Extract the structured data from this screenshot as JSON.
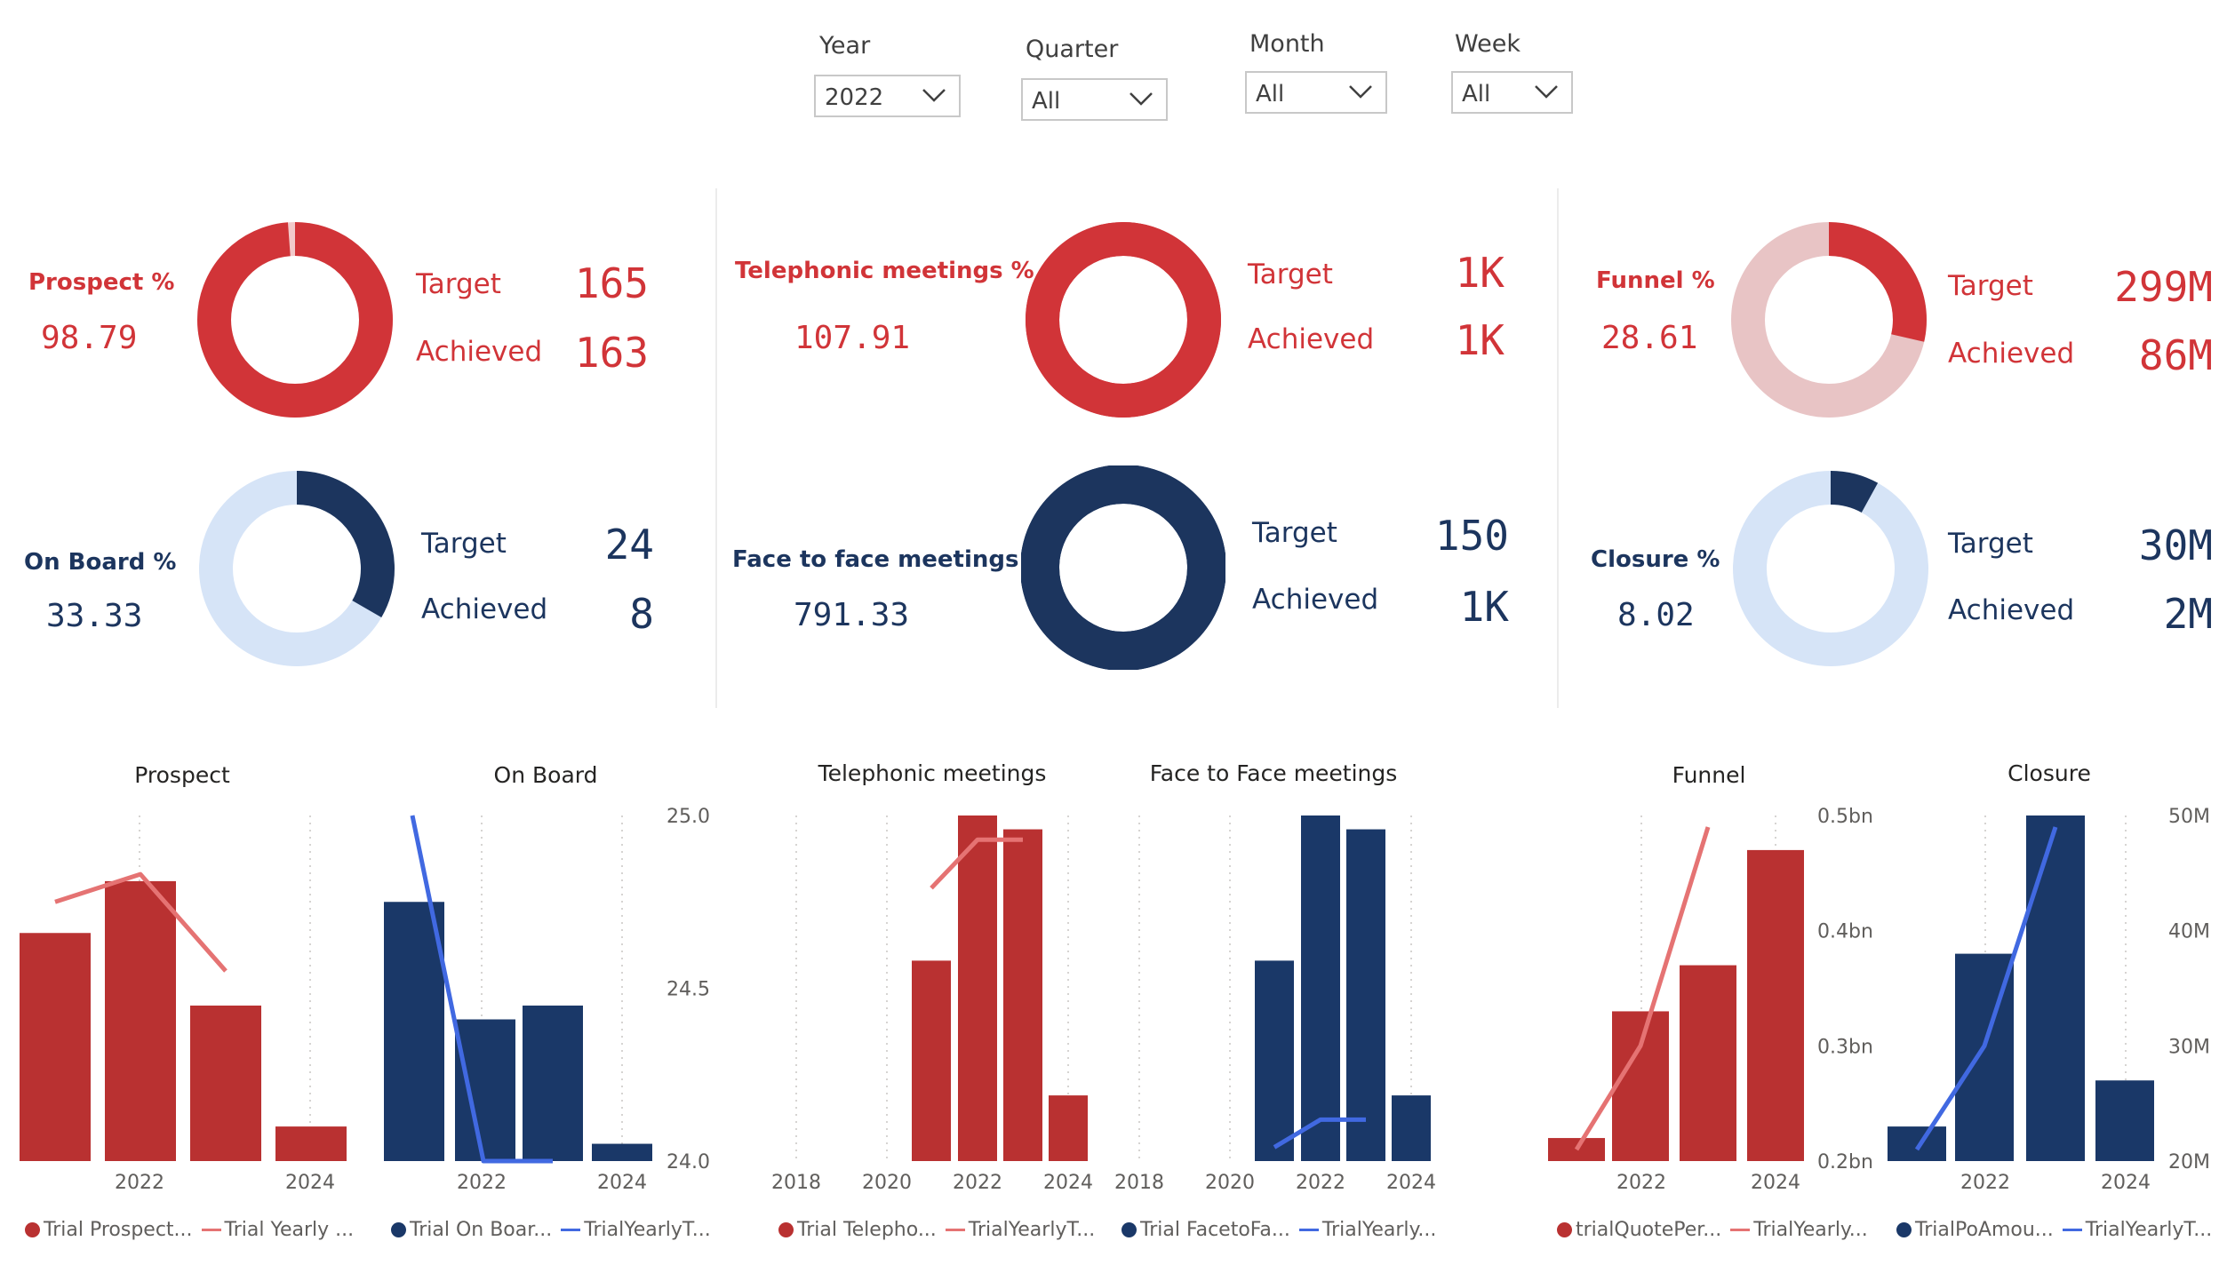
{
  "filters": [
    {
      "label": "Year",
      "value": "2022"
    },
    {
      "label": "Quarter",
      "value": "All"
    },
    {
      "label": "Month",
      "value": "All"
    },
    {
      "label": "Week",
      "value": "All"
    }
  ],
  "kpis": {
    "prospect": {
      "title": "Prospect %",
      "pct": "98.79",
      "target_label": "Target",
      "target": "165",
      "achieved_label": "Achieved",
      "achieved": "163",
      "progress": 0.9879
    },
    "onboard": {
      "title": "On Board %",
      "pct": "33.33",
      "target_label": "Target",
      "target": "24",
      "achieved_label": "Achieved",
      "achieved": "8",
      "progress": 0.3333
    },
    "telephonic": {
      "title": "Telephonic meetings %",
      "pct": "107.91",
      "target_label": "Target",
      "target": "1K",
      "achieved_label": "Achieved",
      "achieved": "1K",
      "progress": 1.0
    },
    "facetoface": {
      "title": "Face to face meetings %",
      "pct": "791.33",
      "target_label": "Target",
      "target": "150",
      "achieved_label": "Achieved",
      "achieved": "1K",
      "progress": 1.0
    },
    "funnel": {
      "title": "Funnel %",
      "pct": "28.61",
      "target_label": "Target",
      "target": "299M",
      "achieved_label": "Achieved",
      "achieved": "86M",
      "progress": 0.2861
    },
    "closure": {
      "title": "Closure %",
      "pct": "8.02",
      "target_label": "Target",
      "target": "30M",
      "achieved_label": "Achieved",
      "achieved": "2M",
      "progress": 0.0802
    }
  },
  "colors": {
    "red": "#d13438",
    "bar_red": "#b93131",
    "line_red": "#e57373",
    "navy": "#1c355e",
    "bar_navy": "#1a3868",
    "line_blue": "#4169e1",
    "light_red": "#e8c4c5",
    "light_blue": "#d6e4f7"
  },
  "chart_data": [
    {
      "type": "bar",
      "title": "Prospect",
      "x": [
        2021,
        2022,
        2023,
        2024
      ],
      "xticks": [
        "2022",
        "2024"
      ],
      "series": [
        {
          "name": "Trial Prospect...",
          "kind": "bar",
          "values": [
            66,
            81,
            45,
            10
          ]
        },
        {
          "name": "Trial Yearly ...",
          "kind": "line",
          "values": [
            75,
            83,
            55,
            null
          ]
        }
      ],
      "ylim": [
        0,
        100
      ],
      "y2ticks": []
    },
    {
      "type": "bar",
      "title": "On Board",
      "x": [
        2021,
        2022,
        2023,
        2024
      ],
      "xticks": [
        "2022",
        "2024"
      ],
      "series": [
        {
          "name": "Trial On Boar...",
          "kind": "bar",
          "values": [
            75,
            41,
            45,
            5
          ]
        },
        {
          "name": "TrialYearlyT...",
          "kind": "line",
          "values": [
            25.0,
            24.0,
            24.0,
            null
          ]
        }
      ],
      "ylim": [
        0,
        100
      ],
      "y2lim": [
        24.0,
        25.0
      ],
      "y2ticks": [
        "25.0",
        "24.5",
        "24.0"
      ]
    },
    {
      "type": "bar",
      "title": "Telephonic meetings",
      "x": [
        2021,
        2022,
        2023,
        2024
      ],
      "xlim": [
        2017.5,
        2024.5
      ],
      "xticks": [
        "2018",
        "2020",
        "2022",
        "2024"
      ],
      "series": [
        {
          "name": "Trial Telepho...",
          "kind": "bar",
          "values": [
            58,
            100,
            96,
            19
          ]
        },
        {
          "name": "TrialYearlyT...",
          "kind": "line",
          "values": [
            79,
            93,
            93,
            null
          ]
        }
      ],
      "ylim": [
        0,
        100
      ],
      "y2ticks": []
    },
    {
      "type": "bar",
      "title": "Face to Face meetings",
      "x": [
        2021,
        2022,
        2023,
        2024
      ],
      "xlim": [
        2017.5,
        2024.5
      ],
      "xticks": [
        "2018",
        "2020",
        "2022",
        "2024"
      ],
      "series": [
        {
          "name": "Trial FacetoFa...",
          "kind": "bar",
          "values": [
            58,
            100,
            96,
            19
          ]
        },
        {
          "name": "TrialYearly...",
          "kind": "line",
          "values": [
            4,
            12,
            12,
            null
          ]
        }
      ],
      "ylim": [
        0,
        100
      ],
      "y2ticks": []
    },
    {
      "type": "bar",
      "title": "Funnel",
      "x": [
        2021,
        2022,
        2023,
        2024
      ],
      "xticks": [
        "2022",
        "2024"
      ],
      "series": [
        {
          "name": "trialQuotePer...",
          "kind": "bar",
          "values": [
            0.22,
            0.33,
            0.37,
            0.47
          ]
        },
        {
          "name": "TrialYearly...",
          "kind": "line",
          "values": [
            0.21,
            0.3,
            0.49,
            null
          ]
        }
      ],
      "ylim": [
        0.2,
        0.5
      ],
      "y2ticks": [
        "0.5bn",
        "0.4bn",
        "0.3bn",
        "0.2bn"
      ]
    },
    {
      "type": "bar",
      "title": "Closure",
      "x": [
        2021,
        2022,
        2023,
        2024
      ],
      "xticks": [
        "2022",
        "2024"
      ],
      "series": [
        {
          "name": "TrialPoAmou...",
          "kind": "bar",
          "values": [
            23,
            38,
            50,
            27
          ]
        },
        {
          "name": "TrialYearlyT...",
          "kind": "line",
          "values": [
            21,
            30,
            49,
            null
          ]
        }
      ],
      "ylim": [
        20,
        50
      ],
      "y2ticks": [
        "50M",
        "40M",
        "30M",
        "20M"
      ]
    }
  ]
}
